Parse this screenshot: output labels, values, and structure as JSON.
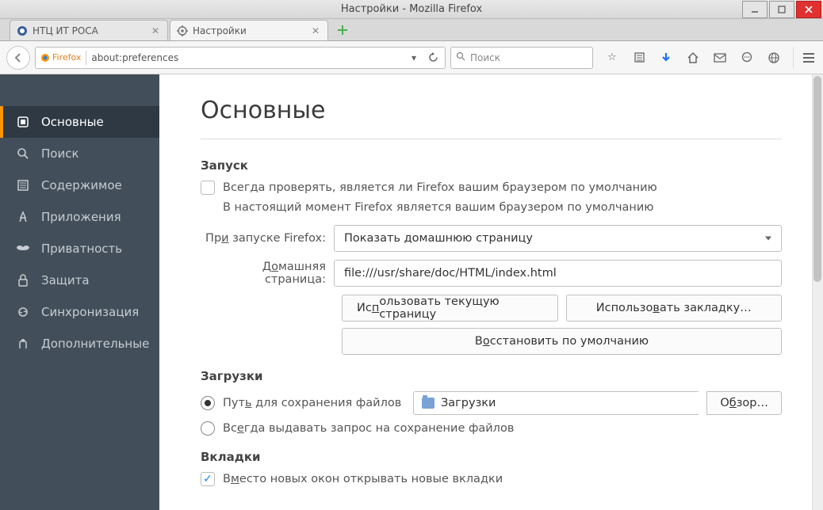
{
  "window": {
    "title": "Настройки - Mozilla Firefox"
  },
  "tabs": [
    {
      "label": "НТЦ ИТ РОСА",
      "icon": "rosa-icon"
    },
    {
      "label": "Настройки",
      "icon": "gear-icon"
    }
  ],
  "urlbar": {
    "identity": "Firefox",
    "url": "about:preferences"
  },
  "searchbar": {
    "placeholder": "Поиск"
  },
  "sidebar": {
    "items": [
      {
        "label": "Основные"
      },
      {
        "label": "Поиск"
      },
      {
        "label": "Содержимое"
      },
      {
        "label": "Приложения"
      },
      {
        "label": "Приватность"
      },
      {
        "label": "Защита"
      },
      {
        "label": "Синхронизация"
      },
      {
        "label": "Дополнительные"
      }
    ]
  },
  "main": {
    "heading": "Основные",
    "startup": {
      "title": "Запуск",
      "check_default_label": "Всегда проверять, является ли Firefox вашим браузером по умолчанию",
      "is_default_msg": "В настоящий момент Firefox является вашим браузером по умолчанию",
      "startup_label": "При запуске Firefox:",
      "startup_value": "Показать домашнюю страницу",
      "homepage_label": "Домашняя страница:",
      "homepage_value": "file:///usr/share/doc/HTML/index.html",
      "btn_current": "Использовать текущую страницу",
      "btn_bookmark": "Использовать закладку…",
      "btn_restore": "Восстановить по умолчанию"
    },
    "downloads": {
      "title": "Загрузки",
      "save_to_label": "Путь для сохранения файлов",
      "save_to_path": "Загрузки",
      "browse_label": "Обзор…",
      "always_ask_label": "Всегда выдавать запрос на сохранение файлов"
    },
    "tabs_section": {
      "title": "Вкладки",
      "open_new_tabs_label": "Вместо новых окон открывать новые вкладки"
    }
  }
}
